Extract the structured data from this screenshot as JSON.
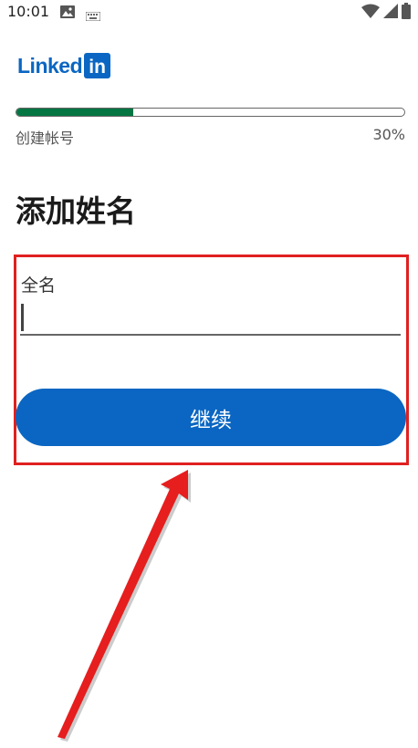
{
  "status_bar": {
    "time": "10:01",
    "icons": [
      "gallery-icon",
      "keyboard-icon",
      "wifi-icon",
      "signal-icon",
      "battery-icon"
    ]
  },
  "logo": {
    "text": "Linked",
    "box_text": "in",
    "brand_color": "#0a66c2"
  },
  "progress": {
    "label": "创建帐号",
    "percent_text": "30%",
    "fraction": 0.3,
    "fill_color": "#057642"
  },
  "page": {
    "title": "添加姓名"
  },
  "form": {
    "full_name_label": "全名",
    "full_name_value": ""
  },
  "actions": {
    "continue_label": "继续"
  },
  "annotation": {
    "highlight_color": "#e02020"
  }
}
